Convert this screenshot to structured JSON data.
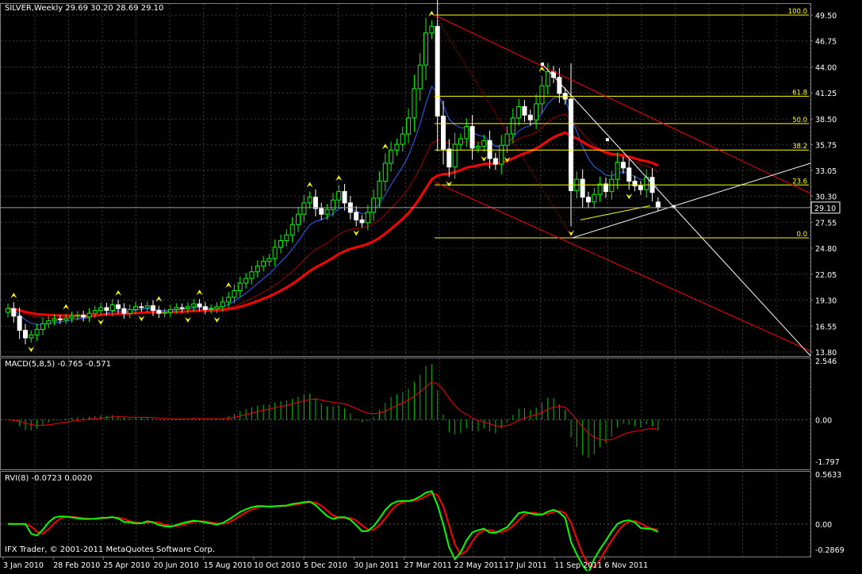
{
  "colors": {
    "background": "#000000",
    "grid": "#3a3a3a",
    "axis_text": "#ffffff",
    "bull_candle": "#00ff00",
    "bear_candle": "#ffffff",
    "ma_red": "#ff0000",
    "ma_blue": "#2f64ff",
    "ma_darkred": "#a00000",
    "fib": "#ffff00",
    "channel": "#ff0000",
    "trend_white": "#ffffff",
    "macd_hist": "#00c000",
    "macd_signal": "#ff0000",
    "rvi_main": "#00ff00",
    "rvi_signal": "#ff0000",
    "fractal": "#ffff00",
    "current_price_box": "#000000"
  },
  "header": {
    "main_title": "SILVER,Weekly  29.69 30.20 28.69 29.10",
    "macd_title": "MACD(5,8,5) -0.765 -0.571",
    "rvi_title": "RVI(8) -0.0723 0.0020",
    "copyright": "IFX Trader, © 2001-2011 MetaQuotes Software Corp."
  },
  "chart_data": [
    {
      "type": "candlestick",
      "title": "SILVER,Weekly",
      "ohlc_last": {
        "open": 29.69,
        "high": 30.2,
        "low": 28.69,
        "close": 29.1
      },
      "current_price_label": "29.10",
      "ylim": [
        13.8,
        49.5
      ],
      "y_ticks": [
        "49.50",
        "46.75",
        "44.00",
        "41.25",
        "38.50",
        "35.75",
        "33.05",
        "30.30",
        "27.55",
        "24.80",
        "22.05",
        "19.30",
        "16.55",
        "13.80"
      ],
      "x_ticks": [
        "3 Jan 2010",
        "28 Feb 2010",
        "25 Apr 2010",
        "20 Jun 2010",
        "15 Aug 2010",
        "10 Oct 2010",
        "5 Dec 2010",
        "30 Jan 2011",
        "27 Mar 2011",
        "22 May 2011",
        "17 Jul 2011",
        "11 Sep 2011",
        "6 Nov 2011"
      ],
      "closes": [
        18.4,
        17.6,
        16.1,
        15.3,
        15.6,
        16.2,
        16.8,
        17.1,
        17.3,
        17.2,
        17.4,
        17.6,
        17.7,
        17.5,
        17.9,
        18.2,
        18.5,
        18.2,
        18.8,
        18.4,
        17.9,
        18.3,
        18.6,
        18.5,
        18.7,
        18.2,
        17.9,
        18.0,
        18.3,
        18.5,
        18.4,
        18.6,
        18.9,
        18.6,
        18.3,
        18.4,
        18.6,
        19.1,
        19.6,
        20.3,
        21.1,
        21.6,
        22.3,
        22.9,
        23.4,
        23.7,
        24.9,
        25.6,
        26.2,
        27.3,
        28.4,
        29.6,
        30.2,
        29.0,
        28.4,
        28.9,
        29.9,
        30.8,
        29.6,
        28.6,
        27.8,
        27.5,
        28.6,
        30.1,
        31.9,
        33.8,
        35.2,
        35.8,
        36.9,
        38.6,
        41.7,
        44.2,
        47.6,
        48.3,
        38.8,
        35.3,
        33.4,
        35.8,
        36.4,
        37.7,
        35.4,
        35.6,
        36.2,
        34.3,
        33.7,
        35.7,
        36.9,
        38.6,
        39.8,
        38.9,
        38.4,
        40.1,
        42.0,
        43.5,
        42.9,
        41.2,
        40.6,
        30.9,
        32.1,
        30.2,
        29.7,
        30.5,
        31.6,
        30.8,
        32.1,
        33.9,
        33.3,
        31.9,
        31.4,
        31.0,
        32.3,
        30.7,
        29.1
      ],
      "fibonacci": {
        "high": 49.5,
        "low": 25.9,
        "levels": [
          {
            "label": "100.0",
            "value": 49.5
          },
          {
            "label": "61.8",
            "value": 40.9
          },
          {
            "label": "50.0",
            "value": 38.0
          },
          {
            "label": "38.2",
            "value": 35.2
          },
          {
            "label": "23.6",
            "value": 31.5
          },
          {
            "label": "0.0",
            "value": 25.9
          }
        ]
      },
      "series": [
        {
          "name": "",
          "kind": "moving-average",
          "color": "#ff0000"
        },
        {
          "name": "",
          "kind": "moving-average",
          "color": "#2f64ff"
        },
        {
          "name": "",
          "kind": "moving-average",
          "color": "#a00000"
        }
      ]
    },
    {
      "type": "bar",
      "title": "MACD(5,8,5) -0.765 -0.571",
      "ylim": [
        -1.797,
        2.546
      ],
      "y_ticks": [
        "2.546",
        "0.00",
        "-1.797"
      ],
      "main_last": -0.765,
      "signal_last": -0.571
    },
    {
      "type": "line",
      "title": "RVI(8) -0.0723 0.0020",
      "ylim": [
        -0.2869,
        0.5633
      ],
      "y_ticks": [
        "0.5633",
        "0.00",
        "-0.2869"
      ],
      "main_last": -0.0723,
      "signal_last": 0.002
    }
  ]
}
